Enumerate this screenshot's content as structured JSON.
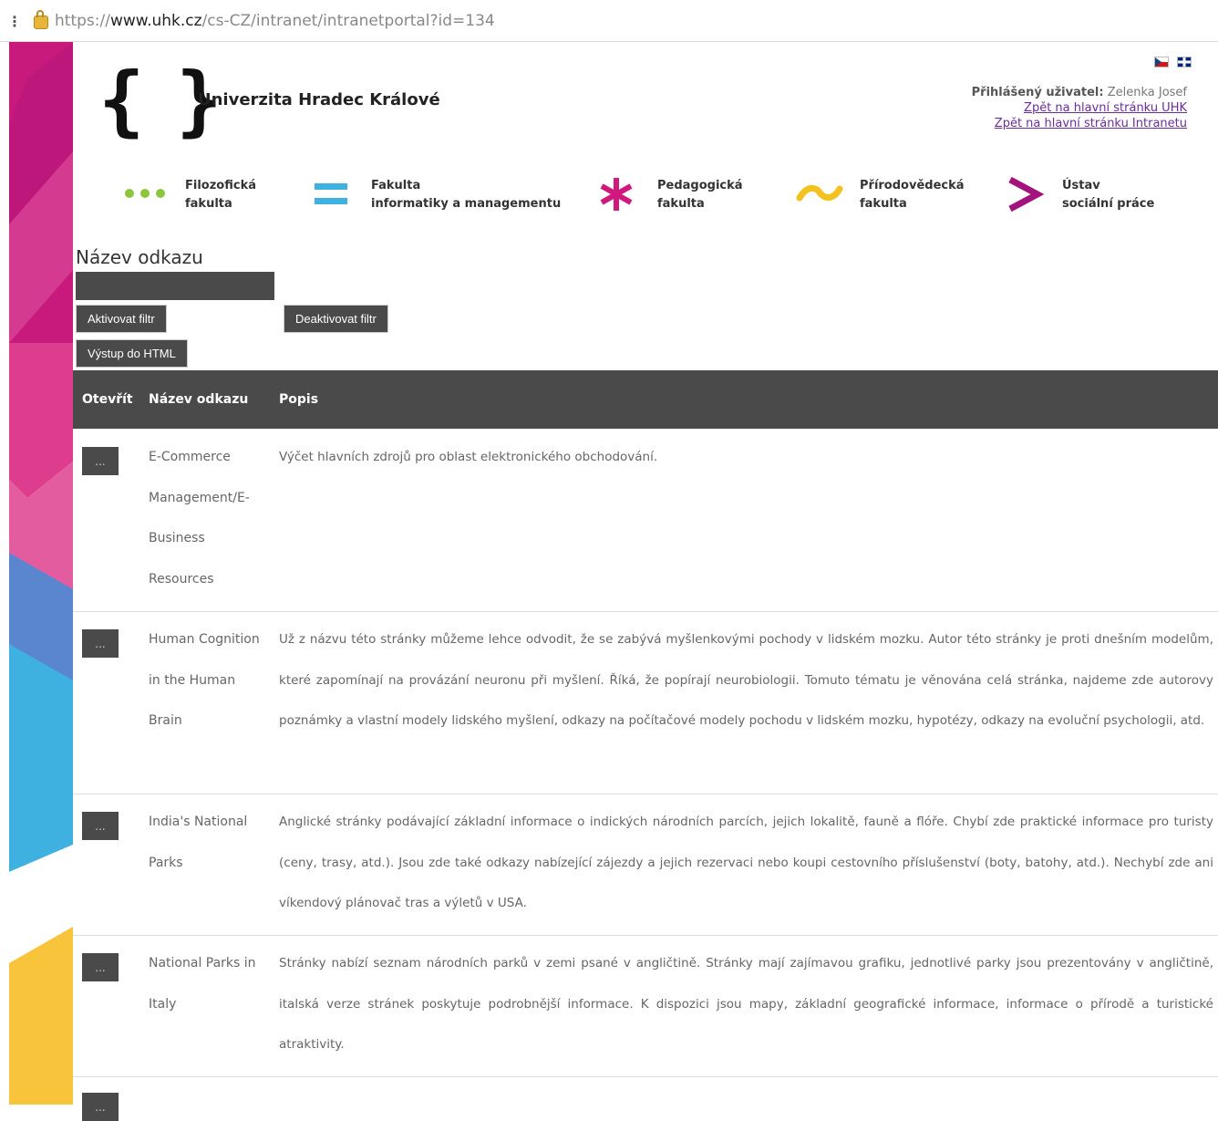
{
  "browser": {
    "url_scheme": "https://",
    "url_host": "www.uhk.cz",
    "url_path": "/cs-CZ/intranet/intranetportal?id=134"
  },
  "header": {
    "logo_braces": "{ }",
    "logo_text": "Univerzita Hradec Králové",
    "user_label": "Přihlášený uživatel:",
    "user_name": "Zelenka Josef",
    "link_uhk": "Zpět na hlavní stránku UHK",
    "link_intranet": "Zpět na hlavní stránku Intranetu"
  },
  "faculties": [
    {
      "line1": "Filozofická",
      "line2": "fakulta",
      "color": "#8cc63f",
      "icon": "dots-icon"
    },
    {
      "line1": "Fakulta",
      "line2": "informatiky a managementu",
      "color": "#3fb1e0",
      "icon": "equals-icon"
    },
    {
      "line1": "Pedagogická",
      "line2": "fakulta",
      "color": "#d0197f",
      "icon": "asterisk-icon"
    },
    {
      "line1": "Přírodovědecká",
      "line2": "fakulta",
      "color": "#f4c21e",
      "icon": "tilde-icon"
    },
    {
      "line1": "Ústav",
      "line2": "sociální práce",
      "color": "#a3137d",
      "icon": "chevron-icon"
    }
  ],
  "filter": {
    "title": "Název odkazu",
    "input_value": "",
    "activate": "Aktivovat filtr",
    "deactivate": "Deaktivovat filtr",
    "export": "Výstup do HTML"
  },
  "table": {
    "headers": [
      "Otevřít",
      "Název odkazu",
      "Popis"
    ],
    "open_label": "...",
    "rows": [
      {
        "name": "E-Commerce Management/E-Business Resources",
        "desc": "Výčet hlavních zdrojů pro oblast elektronického obchodování."
      },
      {
        "name": "Human Cognition in the Human Brain",
        "desc": "Už z názvu této stránky můžeme lehce odvodit, že se zabývá myšlenkovými pochody v lidském mozku. Autor této stránky je proti dnešním modelům, které zapomínají na provázání neuronu při myšlení. Říká, že popírají neurobiologii. Tomuto tématu je věnována celá stránka, najdeme zde autorovy poznámky a vlastní modely lidského myšlení, odkazy na počítačové modely pochodu v lidském mozku, hypotézy, odkazy na evoluční psychologii, atd."
      },
      {
        "name": "India's National Parks",
        "desc": "Anglické stránky podávající základní informace o indických národních parcích, jejich lokalitě, fauně a flóře. Chybí zde praktické informace pro turisty (ceny, trasy, atd.). Jsou zde také odkazy nabízející zájezdy a jejich rezervaci nebo koupi cestovního příslušenství (boty, batohy, atd.). Nechybí zde ani víkendový plánovač tras a výletů v USA."
      },
      {
        "name": "National Parks in Italy",
        "desc": "Stránky nabízí seznam národních parků v zemi psané v angličtině. Stránky mají zajímavou grafiku, jednotlivé parky jsou prezentovány v angličtině, italská verze stránek poskytuje podrobnější informace. K dispozici jsou mapy, základní geografické informace, informace o přírodě a turistické atraktivity."
      }
    ]
  }
}
